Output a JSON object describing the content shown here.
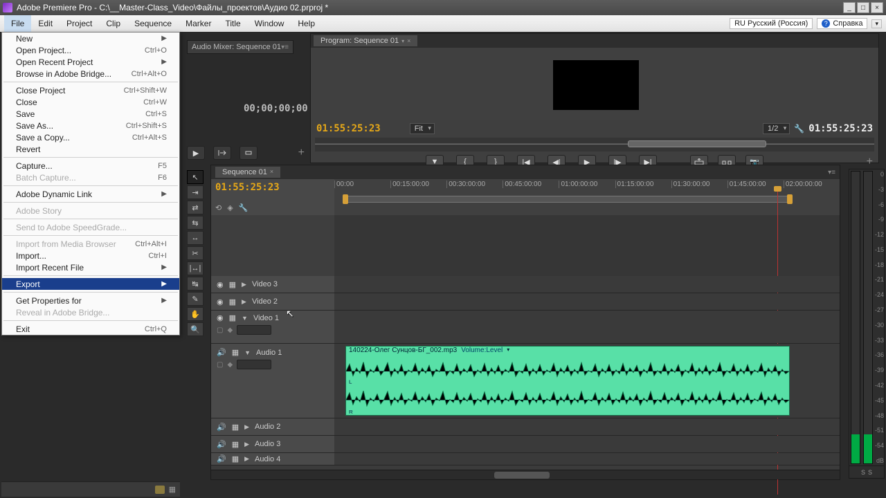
{
  "title": "Adobe Premiere Pro - C:\\__Master-Class_Video\\Файлы_проектов\\Аудио 02.prproj *",
  "menubar": [
    "File",
    "Edit",
    "Project",
    "Clip",
    "Sequence",
    "Marker",
    "Title",
    "Window",
    "Help"
  ],
  "lang": "RU Русский (Россия)",
  "help_label": "Справка",
  "file_menu": [
    {
      "label": "New",
      "arrow": true
    },
    {
      "label": "Open Project...",
      "sc": "Ctrl+O"
    },
    {
      "label": "Open Recent Project",
      "arrow": true
    },
    {
      "label": "Browse in Adobe Bridge...",
      "sc": "Ctrl+Alt+O"
    },
    {
      "sep": true
    },
    {
      "label": "Close Project",
      "sc": "Ctrl+Shift+W"
    },
    {
      "label": "Close",
      "sc": "Ctrl+W"
    },
    {
      "label": "Save",
      "sc": "Ctrl+S"
    },
    {
      "label": "Save As...",
      "sc": "Ctrl+Shift+S"
    },
    {
      "label": "Save a Copy...",
      "sc": "Ctrl+Alt+S"
    },
    {
      "label": "Revert"
    },
    {
      "sep": true
    },
    {
      "label": "Capture...",
      "sc": "F5"
    },
    {
      "label": "Batch Capture...",
      "sc": "F6",
      "disabled": true
    },
    {
      "sep": true
    },
    {
      "label": "Adobe Dynamic Link",
      "arrow": true
    },
    {
      "sep": true
    },
    {
      "label": "Adobe Story",
      "disabled": true
    },
    {
      "sep": true
    },
    {
      "label": "Send to Adobe SpeedGrade...",
      "disabled": true
    },
    {
      "sep": true
    },
    {
      "label": "Import from Media Browser",
      "sc": "Ctrl+Alt+I",
      "disabled": true
    },
    {
      "label": "Import...",
      "sc": "Ctrl+I"
    },
    {
      "label": "Import Recent File",
      "arrow": true
    },
    {
      "sep": true
    },
    {
      "label": "Export",
      "arrow": true,
      "highlight": true
    },
    {
      "sep": true
    },
    {
      "label": "Get Properties for",
      "arrow": true
    },
    {
      "label": "Reveal in Adobe Bridge...",
      "disabled": true
    },
    {
      "sep": true
    },
    {
      "label": "Exit",
      "sc": "Ctrl+Q"
    }
  ],
  "audio_mixer_tab": "Audio Mixer: Sequence 01",
  "source_tc": "00;00;00;00",
  "program": {
    "tab": "Program: Sequence 01",
    "tc_left": "01:55:25:23",
    "tc_right": "01:55:25:23",
    "fit": "Fit",
    "scale": "1/2"
  },
  "timeline": {
    "tab": "Sequence 01",
    "tc": "01:55:25:23",
    "ticks": [
      "00:00",
      "00:15:00:00",
      "00:30:00:00",
      "00:45:00:00",
      "01:00:00:00",
      "01:15:00:00",
      "01:30:00:00",
      "01:45:00:00",
      "02:00:00:00"
    ],
    "video_tracks": [
      "Video 3",
      "Video 2",
      "Video 1"
    ],
    "audio_tracks": [
      "Audio 1",
      "Audio 2",
      "Audio 3",
      "Audio 4"
    ],
    "clip_name": "140224-Олег Сунцов-БГ_002.mp3",
    "clip_effect": "Volume:Level"
  },
  "meter_labels": [
    "0",
    "-3",
    "-6",
    "-9",
    "-12",
    "-15",
    "-18",
    "-21",
    "-24",
    "-27",
    "-30",
    "-33",
    "-36",
    "-39",
    "-42",
    "-45",
    "-48",
    "-51",
    "-54",
    "dB"
  ],
  "meter_foot": [
    "S",
    "S"
  ]
}
